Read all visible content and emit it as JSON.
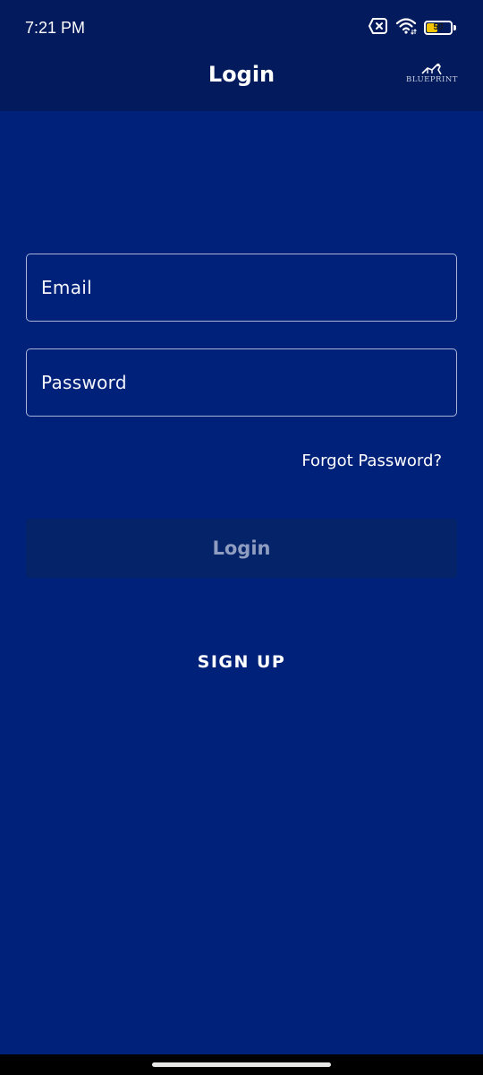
{
  "status_bar": {
    "time": "7:21 PM",
    "battery_level": "50",
    "battery_fill_fraction": 0.5,
    "battery_color": "#f5c400",
    "icons": [
      "sim-error-icon",
      "wifi-icon",
      "battery-icon"
    ]
  },
  "header": {
    "title": "Login",
    "logo_text": "BLUEPRINT"
  },
  "form": {
    "email_label": "Email",
    "password_label": "Password",
    "forgot_password": "Forgot Password?",
    "login_button": "Login",
    "signup_link": "SIGN UP"
  },
  "colors": {
    "background": "#002179",
    "header": "#031b5c",
    "field_border": "#a7b3d8",
    "login_button_bg": "#052369",
    "login_button_text": "#8f9dc1"
  }
}
